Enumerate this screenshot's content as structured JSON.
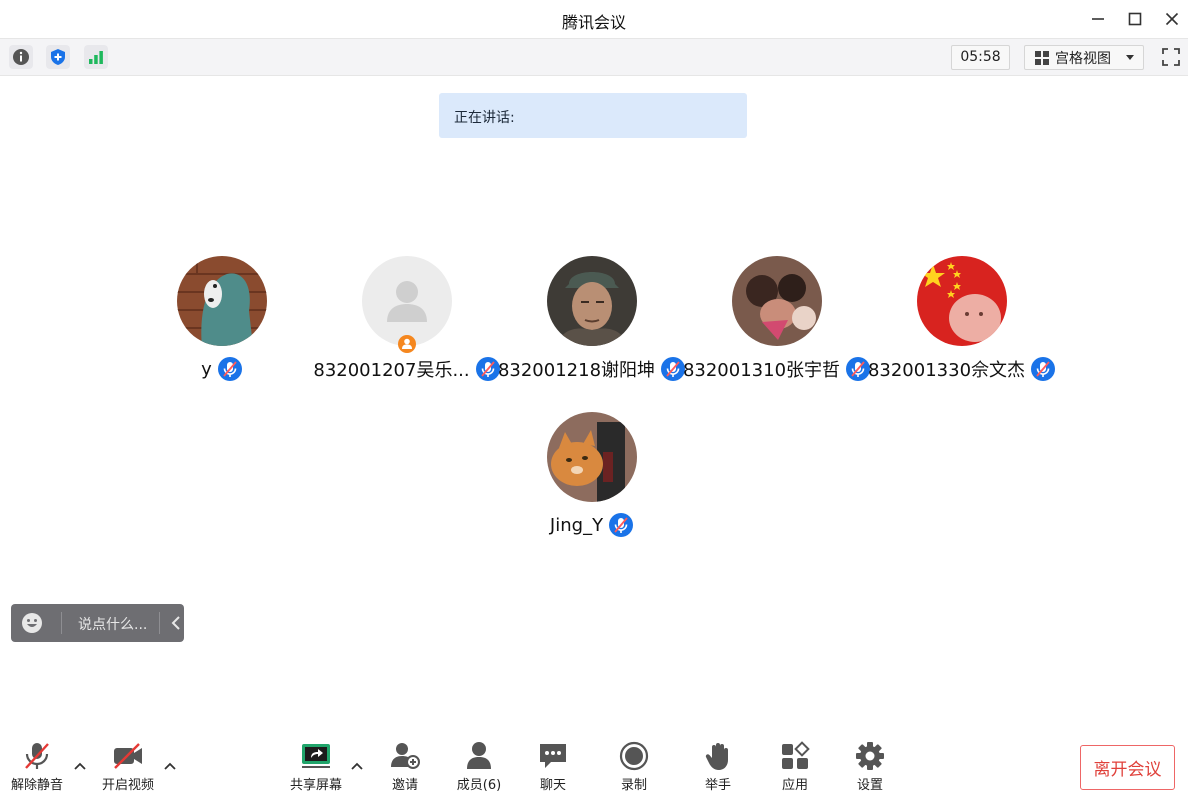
{
  "window": {
    "title": "腾讯会议"
  },
  "toolbar": {
    "timer": "05:58",
    "view_label": "宫格视图"
  },
  "speaking": {
    "label": "正在讲话:"
  },
  "participants": [
    {
      "name": "y",
      "avatar": "hooded-bear-photo"
    },
    {
      "name": "832001207吴乐...",
      "avatar": "default-avatar"
    },
    {
      "name": "832001218谢阳坤",
      "avatar": "man-photo"
    },
    {
      "name": "832001310张宇哲",
      "avatar": "group-photo"
    },
    {
      "name": "832001330佘文杰",
      "avatar": "flag-child-photo"
    },
    {
      "name": "Jing_Y",
      "avatar": "cat-photo"
    }
  ],
  "reaction": {
    "placeholder": "说点什么..."
  },
  "bottom": {
    "unmute": "解除静音",
    "video": "开启视频",
    "share": "共享屏幕",
    "invite": "邀请",
    "members": "成员(6)",
    "chat": "聊天",
    "record": "录制",
    "raise_hand": "举手",
    "apps": "应用",
    "settings": "设置",
    "leave": "离开会议"
  },
  "colors": {
    "accent": "#1a73e8",
    "speaking_bg": "#dbe9fb",
    "leave_red": "#e0413b"
  }
}
